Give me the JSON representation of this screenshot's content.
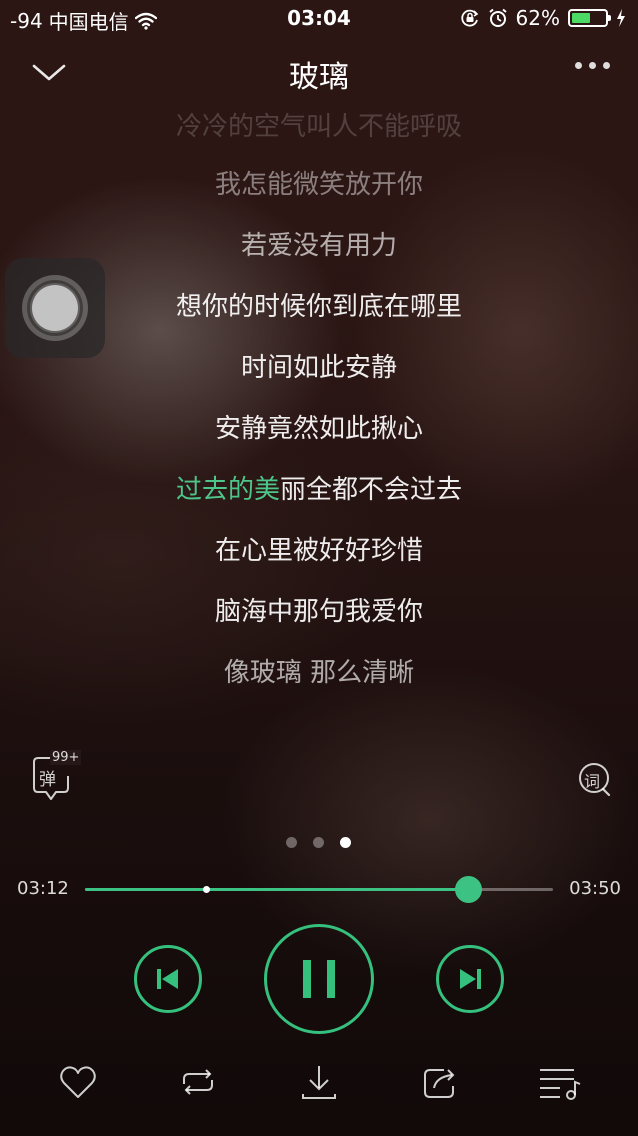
{
  "status_bar": {
    "signal": "-94",
    "carrier": "中国电信",
    "time": "03:04",
    "battery_percent": "62%",
    "battery_level": 0.62
  },
  "header": {
    "title": "玻璃"
  },
  "lyrics": [
    {
      "text": "冷冷的空气叫人不能呼吸"
    },
    {
      "text": "我怎能微笑放开你"
    },
    {
      "text": "若爱没有用力"
    },
    {
      "text": "想你的时候你到底在哪里"
    },
    {
      "text": "时间如此安静"
    },
    {
      "text": "安静竟然如此揪心"
    },
    {
      "sung": "过去的美",
      "unsung": "丽全都不会过去"
    },
    {
      "text": "在心里被好好珍惜"
    },
    {
      "text": "脑海中那句我爱你"
    },
    {
      "text": "像玻璃 那么清晰"
    }
  ],
  "danmu": {
    "label": "弹",
    "badge": "99+"
  },
  "lyric_button": {
    "label": "词"
  },
  "pages": {
    "count": 3,
    "active": 3
  },
  "progress": {
    "elapsed": "03:12",
    "total": "03:50",
    "fraction": 0.818,
    "marker_fraction": 0.258
  },
  "colors": {
    "accent": "#3cc383",
    "lyric_highlight": "#4dc68a",
    "battery": "#4cd964"
  },
  "icons": {
    "back": "chevron-down-icon",
    "more": "more-dots-icon",
    "prev": "skip-previous-icon",
    "play_state": "pause-icon",
    "next": "skip-next-icon",
    "bottom": [
      "heart-icon",
      "repeat-icon",
      "download-icon",
      "share-icon",
      "playlist-icon"
    ]
  }
}
